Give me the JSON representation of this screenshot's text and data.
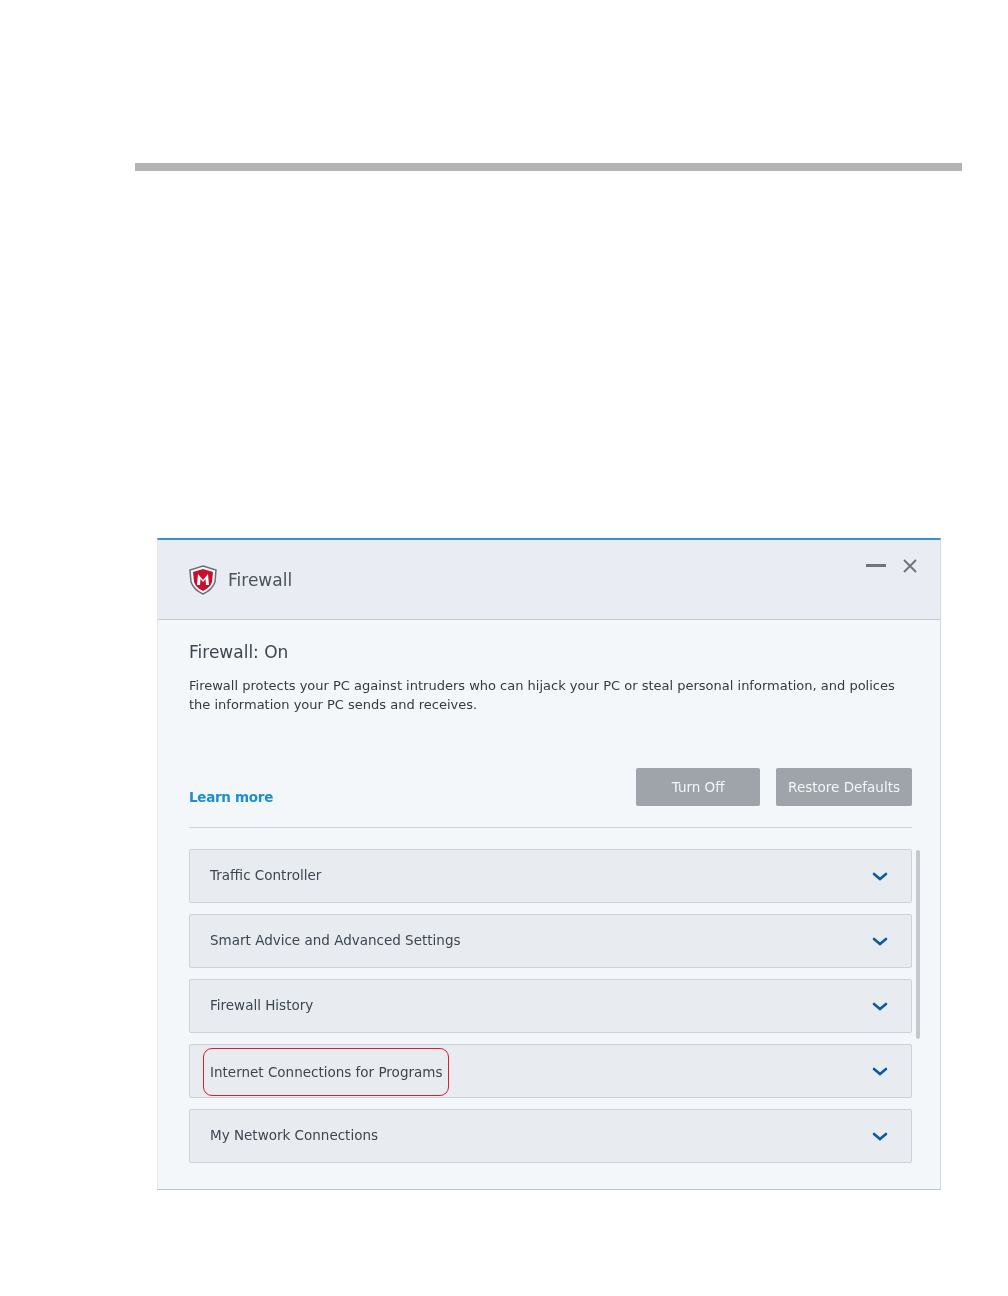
{
  "window": {
    "title": "Firewall"
  },
  "status": {
    "heading": "Firewall: On",
    "description": "Firewall protects your PC against intruders who can hijack your PC or steal personal information, and polices the information your PC sends and receives.",
    "link": "Learn more"
  },
  "buttons": [
    "Turn Off",
    "Restore Defaults"
  ],
  "sections": [
    {
      "label": "Traffic Controller",
      "expanded": false,
      "highlighted": false
    },
    {
      "label": "Smart Advice and Advanced Settings",
      "expanded": false,
      "highlighted": false
    },
    {
      "label": "Firewall History",
      "expanded": false,
      "highlighted": false
    },
    {
      "label": "Internet Connections for Programs",
      "expanded": false,
      "highlighted": true
    },
    {
      "label": "My Network Connections",
      "expanded": false,
      "highlighted": false
    }
  ]
}
